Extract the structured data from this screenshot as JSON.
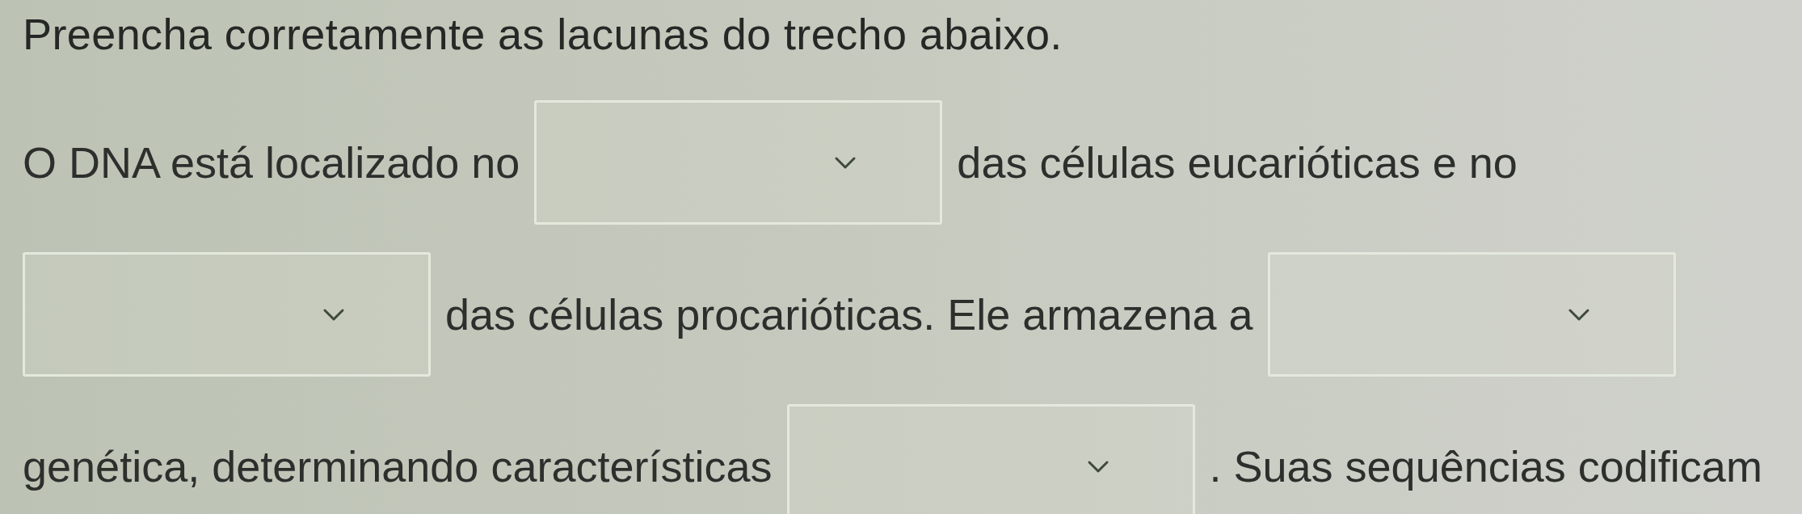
{
  "instruction": "Preencha corretamente as lacunas do trecho abaixo.",
  "passage": {
    "lines": [
      {
        "segments": [
          {
            "kind": "text",
            "text": "O DNA está localizado no"
          },
          {
            "kind": "dropdown"
          },
          {
            "kind": "text",
            "text": "das células eucarióticas e no"
          }
        ]
      },
      {
        "segments": [
          {
            "kind": "dropdown"
          },
          {
            "kind": "text",
            "text": "das células procarióticas. Ele armazena a"
          },
          {
            "kind": "dropdown"
          }
        ]
      },
      {
        "segments": [
          {
            "kind": "text",
            "text": "genética, determinando características"
          },
          {
            "kind": "dropdown"
          },
          {
            "kind": "text",
            "text": ". Suas sequências codificam"
          }
        ]
      }
    ]
  }
}
